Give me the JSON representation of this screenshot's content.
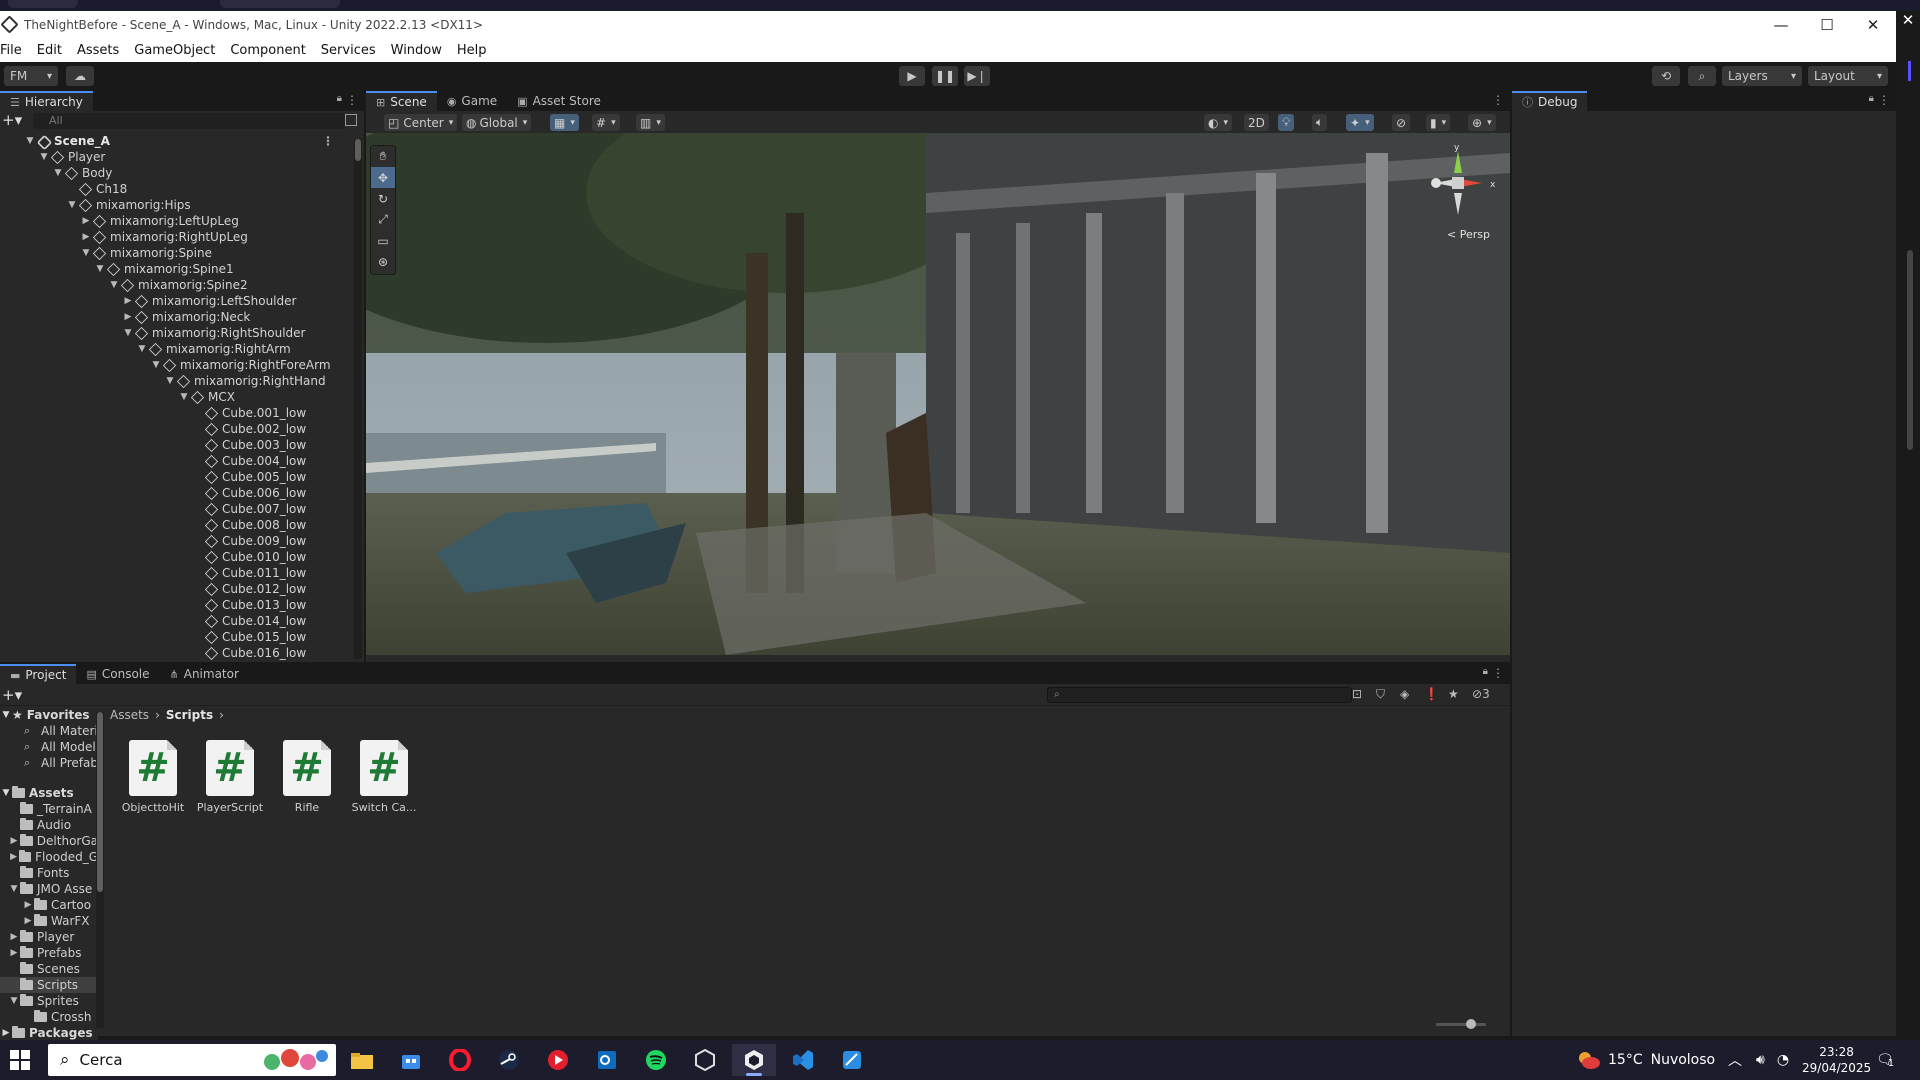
{
  "window": {
    "title": "TheNightBefore - Scene_A - Windows, Mac, Linux - Unity 2022.2.13 <DX11>",
    "minimize_glyph": "—",
    "maximize_glyph": "☐",
    "close_glyph": "✕"
  },
  "menu": [
    "File",
    "Edit",
    "Assets",
    "GameObject",
    "Component",
    "Services",
    "Window",
    "Help"
  ],
  "toolbar": {
    "account": "FM",
    "layers": "Layers",
    "layout": "Layout"
  },
  "hierarchy": {
    "tab": "Hierarchy",
    "search_placeholder": "All",
    "rows": [
      {
        "label": "Scene_A",
        "depth": 0,
        "arrow": "▼",
        "kind": "scene"
      },
      {
        "label": "Player",
        "depth": 1,
        "arrow": "▼"
      },
      {
        "label": "Body",
        "depth": 2,
        "arrow": "▼"
      },
      {
        "label": "Ch18",
        "depth": 3,
        "arrow": ""
      },
      {
        "label": "mixamorig:Hips",
        "depth": 3,
        "arrow": "▼"
      },
      {
        "label": "mixamorig:LeftUpLeg",
        "depth": 4,
        "arrow": "▶"
      },
      {
        "label": "mixamorig:RightUpLeg",
        "depth": 4,
        "arrow": "▶"
      },
      {
        "label": "mixamorig:Spine",
        "depth": 4,
        "arrow": "▼"
      },
      {
        "label": "mixamorig:Spine1",
        "depth": 5,
        "arrow": "▼"
      },
      {
        "label": "mixamorig:Spine2",
        "depth": 6,
        "arrow": "▼"
      },
      {
        "label": "mixamorig:LeftShoulder",
        "depth": 7,
        "arrow": "▶"
      },
      {
        "label": "mixamorig:Neck",
        "depth": 7,
        "arrow": "▶"
      },
      {
        "label": "mixamorig:RightShoulder",
        "depth": 7,
        "arrow": "▼"
      },
      {
        "label": "mixamorig:RightArm",
        "depth": 8,
        "arrow": "▼"
      },
      {
        "label": "mixamorig:RightForeArm",
        "depth": 9,
        "arrow": "▼"
      },
      {
        "label": "mixamorig:RightHand",
        "depth": 10,
        "arrow": "▼"
      },
      {
        "label": "MCX",
        "depth": 11,
        "arrow": "▼"
      },
      {
        "label": "Cube.001_low",
        "depth": 12,
        "arrow": ""
      },
      {
        "label": "Cube.002_low",
        "depth": 12,
        "arrow": ""
      },
      {
        "label": "Cube.003_low",
        "depth": 12,
        "arrow": ""
      },
      {
        "label": "Cube.004_low",
        "depth": 12,
        "arrow": ""
      },
      {
        "label": "Cube.005_low",
        "depth": 12,
        "arrow": ""
      },
      {
        "label": "Cube.006_low",
        "depth": 12,
        "arrow": ""
      },
      {
        "label": "Cube.007_low",
        "depth": 12,
        "arrow": ""
      },
      {
        "label": "Cube.008_low",
        "depth": 12,
        "arrow": ""
      },
      {
        "label": "Cube.009_low",
        "depth": 12,
        "arrow": ""
      },
      {
        "label": "Cube.010_low",
        "depth": 12,
        "arrow": ""
      },
      {
        "label": "Cube.011_low",
        "depth": 12,
        "arrow": ""
      },
      {
        "label": "Cube.012_low",
        "depth": 12,
        "arrow": ""
      },
      {
        "label": "Cube.013_low",
        "depth": 12,
        "arrow": ""
      },
      {
        "label": "Cube.014_low",
        "depth": 12,
        "arrow": ""
      },
      {
        "label": "Cube.015_low",
        "depth": 12,
        "arrow": ""
      },
      {
        "label": "Cube.016_low",
        "depth": 12,
        "arrow": ""
      }
    ]
  },
  "scene_view": {
    "tabs": [
      "Scene",
      "Game",
      "Asset Store"
    ],
    "active_tab": "Scene",
    "pivot": "Center",
    "space": "Global",
    "mode_2d": "2D",
    "projection": "Persp",
    "gizmo_axes": {
      "y": "y",
      "x": "x"
    }
  },
  "debug": {
    "tab": "Debug"
  },
  "bottom": {
    "tabs": [
      "Project",
      "Console",
      "Animator"
    ],
    "active_tab": "Project",
    "hidden_count": "3",
    "breadcrumb": [
      "Assets",
      "Scripts"
    ],
    "favorites_label": "Favorites",
    "favorites": [
      "All Materi",
      "All Model",
      "All Prefab"
    ],
    "assets_label": "Assets",
    "folders": [
      {
        "label": "_TerrainA",
        "depth": 1,
        "arrow": ""
      },
      {
        "label": "Audio",
        "depth": 1,
        "arrow": ""
      },
      {
        "label": "DelthorGa",
        "depth": 1,
        "arrow": "▶"
      },
      {
        "label": "Flooded_G",
        "depth": 1,
        "arrow": "▶"
      },
      {
        "label": "Fonts",
        "depth": 1,
        "arrow": ""
      },
      {
        "label": "JMO Asse",
        "depth": 1,
        "arrow": "▼"
      },
      {
        "label": "Cartoo",
        "depth": 2,
        "arrow": "▶"
      },
      {
        "label": "WarFX",
        "depth": 2,
        "arrow": "▶"
      },
      {
        "label": "Player",
        "depth": 1,
        "arrow": "▶"
      },
      {
        "label": "Prefabs",
        "depth": 1,
        "arrow": "▶"
      },
      {
        "label": "Scenes",
        "depth": 1,
        "arrow": ""
      },
      {
        "label": "Scripts",
        "depth": 1,
        "arrow": "",
        "selected": true
      },
      {
        "label": "Sprites",
        "depth": 1,
        "arrow": "▼"
      },
      {
        "label": "Crossh",
        "depth": 2,
        "arrow": ""
      }
    ],
    "packages_label": "Packages",
    "assets": [
      {
        "label": "ObjecttoHit",
        "glyph": "#"
      },
      {
        "label": "PlayerScript",
        "glyph": "#"
      },
      {
        "label": "Rifle",
        "glyph": "#"
      },
      {
        "label": "Switch Ca...",
        "glyph": "#"
      }
    ]
  },
  "taskbar": {
    "search": "Cerca",
    "weather_temp": "15°C",
    "weather_desc": "Nuvoloso",
    "time": "23:28",
    "date": "29/04/2025",
    "notif_count": "1"
  },
  "colors": {
    "accent": "#4d8ff0",
    "panel": "#282828",
    "background": "#191919",
    "script_hash": "#1f7a35"
  }
}
